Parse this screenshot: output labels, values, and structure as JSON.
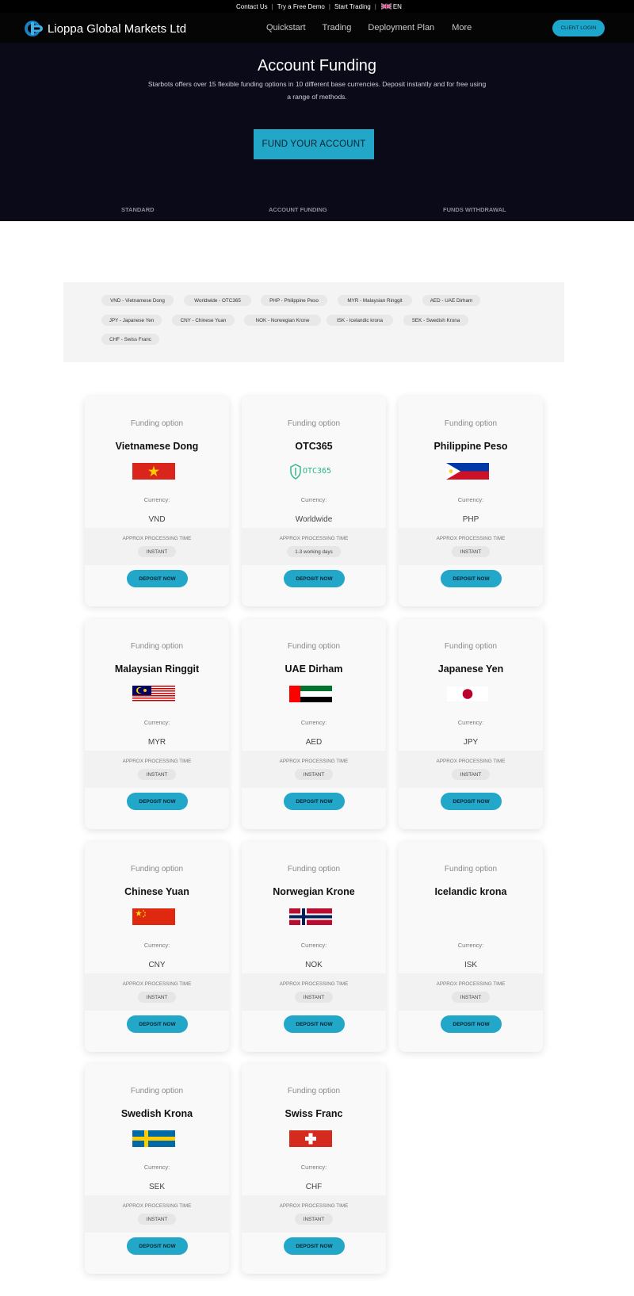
{
  "topbar": {
    "links": [
      "Contact Us",
      "Try a Free Demo",
      "Start Trading"
    ],
    "language": "EN"
  },
  "header": {
    "logo_text": "Lioppa Global Markets Ltd",
    "menu": [
      "Quickstart",
      "Trading",
      "Deployment Plan",
      "More"
    ],
    "client_login": "CLIENT LOGIN"
  },
  "hero": {
    "title": "Account Funding",
    "description": "Starbots offers over 15 flexible funding options in 10 different base currencies. Deposit instantly and for free using a range of methods.",
    "cta": "FUND YOUR ACCOUNT",
    "tabs": [
      "STANDARD",
      "ACCOUNT FUNDING",
      "FUNDS WITHDRAWAL"
    ]
  },
  "filters": {
    "chips": [
      "VND - Vietnamese Dong",
      "Worldwide - OTC365",
      "PHP - Philippine Peso",
      "MYR - Malaysian Ringgit",
      "AED - UAE Dirham",
      "JPY - Japanese Yen",
      "CNY - Chinese Yuan",
      "NOK - Norwegian Krone",
      "ISK - Icelandic krona",
      "SEK - Swedish Krona",
      "CHF - Swiss Franc"
    ]
  },
  "cards_common": {
    "label": "Funding option",
    "currency_label": "Currency:",
    "approx_label": "APPROX PROCESSING TIME",
    "deposit_label": "DEPOSIT NOW"
  },
  "cards": [
    {
      "name": "Vietnamese Dong",
      "currency": "VND",
      "time": "INSTANT",
      "flag": "vietnam-flag"
    },
    {
      "name": "OTC365",
      "currency": "Worldwide",
      "time": "1-3 working days",
      "flag": "otc365-logo",
      "logo_text": "OTC365"
    },
    {
      "name": "Philippine Peso",
      "currency": "PHP",
      "time": "INSTANT",
      "flag": "philippines-flag"
    },
    {
      "name": "Malaysian Ringgit",
      "currency": "MYR",
      "time": "INSTANT",
      "flag": "malaysia-flag"
    },
    {
      "name": "UAE Dirham",
      "currency": "AED",
      "time": "INSTANT",
      "flag": "uae-flag"
    },
    {
      "name": "Japanese Yen",
      "currency": "JPY",
      "time": "INSTANT",
      "flag": "japan-flag"
    },
    {
      "name": "Chinese Yuan",
      "currency": "CNY",
      "time": "INSTANT",
      "flag": "china-flag"
    },
    {
      "name": "Norwegian Krone",
      "currency": "NOK",
      "time": "INSTANT",
      "flag": "norway-flag"
    },
    {
      "name": "Icelandic krona",
      "currency": "ISK",
      "time": "INSTANT",
      "flag": ""
    },
    {
      "name": "Swedish Krona",
      "currency": "SEK",
      "time": "INSTANT",
      "flag": "sweden-flag"
    },
    {
      "name": "Swiss Franc",
      "currency": "CHF",
      "time": "INSTANT",
      "flag": "switzerland-flag"
    }
  ],
  "colors": {
    "accent": "#22a7c9",
    "hero_bg": "#0b0a18",
    "nav_bg": "#050505"
  }
}
